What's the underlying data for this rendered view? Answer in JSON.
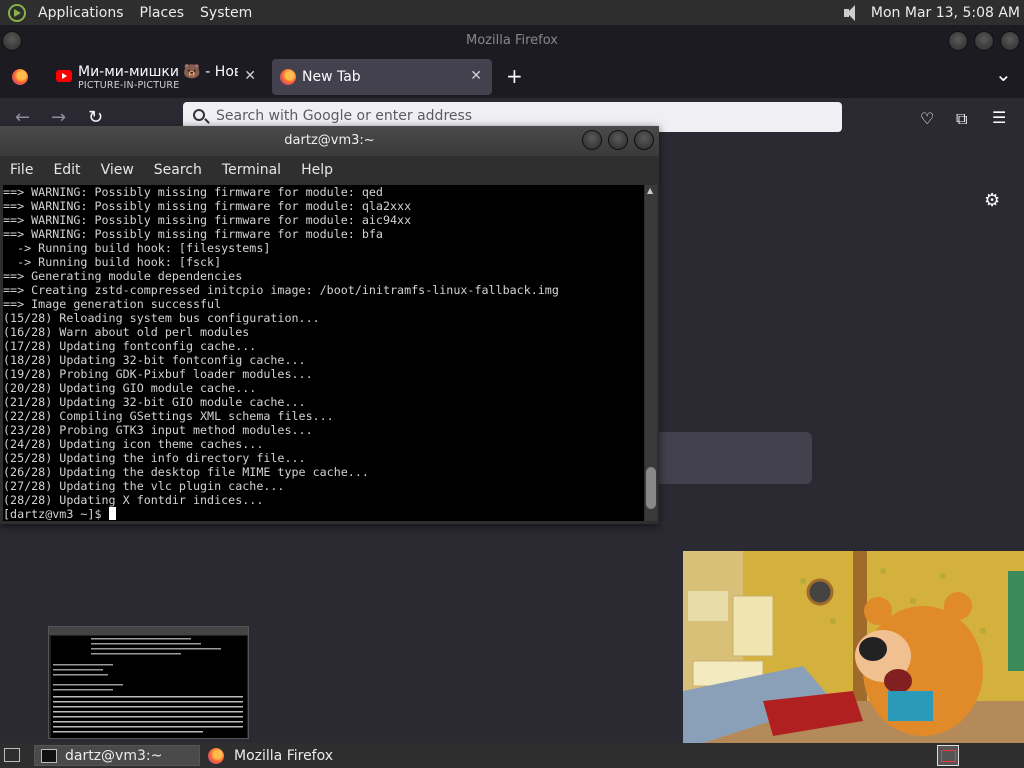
{
  "top_panel": {
    "menus": [
      "Applications",
      "Places",
      "System"
    ],
    "clock": "Mon Mar 13,  5:08 AM"
  },
  "firefox": {
    "title": "Mozilla Firefox",
    "tabs": [
      {
        "title": "Ми-ми-мишки 🐻 - Новые с",
        "subtitle": "PICTURE-IN-PICTURE",
        "close": "✕"
      },
      {
        "title": "New Tab",
        "close": "✕"
      }
    ],
    "new_tab": "+",
    "list_tabs": "⌄",
    "urlbar_placeholder": "Search with Google or enter address",
    "nav": {
      "back": "←",
      "forward": "→",
      "reload": "↻"
    },
    "toolbar_icons": {
      "pocket": "♡",
      "extensions": "⧉",
      "menu": "☰"
    },
    "settings_icon": "⚙"
  },
  "terminal": {
    "title": "dartz@vm3:~",
    "menu": [
      "File",
      "Edit",
      "View",
      "Search",
      "Terminal",
      "Help"
    ],
    "lines": [
      "==> WARNING: Possibly missing firmware for module: qed",
      "==> WARNING: Possibly missing firmware for module: qla2xxx",
      "==> WARNING: Possibly missing firmware for module: aic94xx",
      "==> WARNING: Possibly missing firmware for module: bfa",
      "  -> Running build hook: [filesystems]",
      "  -> Running build hook: [fsck]",
      "==> Generating module dependencies",
      "==> Creating zstd-compressed initcpio image: /boot/initramfs-linux-fallback.img",
      "==> Image generation successful",
      "(15/28) Reloading system bus configuration...",
      "(16/28) Warn about old perl modules",
      "(17/28) Updating fontconfig cache...",
      "(18/28) Updating 32-bit fontconfig cache...",
      "(19/28) Probing GDK-Pixbuf loader modules...",
      "(20/28) Updating GIO module cache...",
      "(21/28) Updating 32-bit GIO module cache...",
      "(22/28) Compiling GSettings XML schema files...",
      "(23/28) Probing GTK3 input method modules...",
      "(24/28) Updating icon theme caches...",
      "(25/28) Updating the info directory file...",
      "(26/28) Updating the desktop file MIME type cache...",
      "(27/28) Updating the vlc plugin cache...",
      "(28/28) Updating X fontdir indices..."
    ],
    "prompt": "[dartz@vm3 ~]$ "
  },
  "taskbar": {
    "items": [
      {
        "label": "dartz@vm3:~",
        "active": true
      },
      {
        "label": "Mozilla Firefox",
        "active": false
      }
    ]
  },
  "colors": {
    "panel": "#2e2e2e",
    "firefox_bg": "#2b2a33",
    "tab_active": "#42414d"
  }
}
